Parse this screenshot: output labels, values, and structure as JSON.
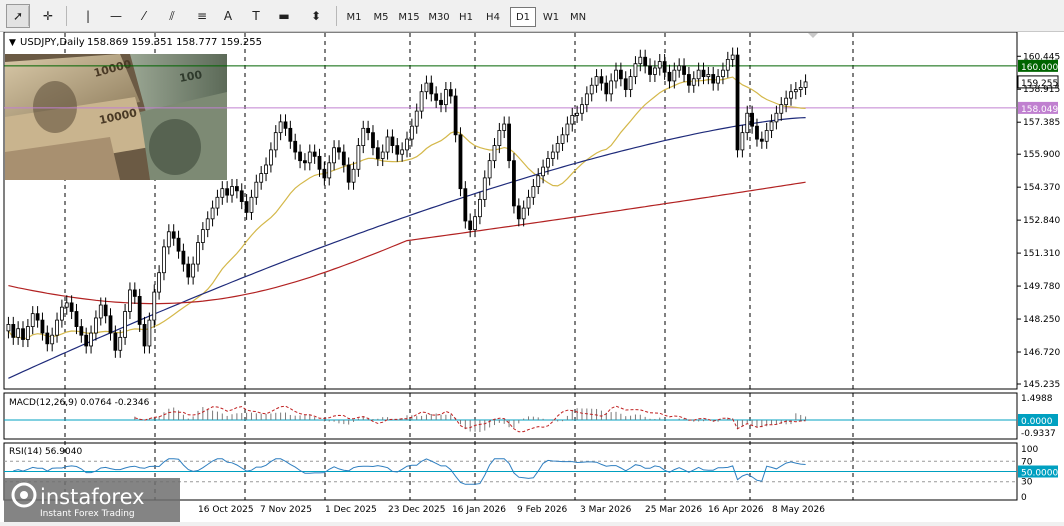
{
  "toolbar": {
    "tools": [
      {
        "name": "cursor-icon",
        "glyph": "➚"
      },
      {
        "name": "crosshair-icon",
        "glyph": "✛"
      },
      {
        "name": "vertical-line-icon",
        "glyph": "|"
      },
      {
        "name": "horizontal-line-icon",
        "glyph": "—"
      },
      {
        "name": "trendline-icon",
        "glyph": "⁄"
      },
      {
        "name": "channel-icon",
        "glyph": "⫽"
      },
      {
        "name": "fibonacci-icon",
        "glyph": "≡"
      },
      {
        "name": "text-icon",
        "glyph": "A"
      },
      {
        "name": "text-label-icon",
        "glyph": "T"
      },
      {
        "name": "rectangle-icon",
        "glyph": "▬"
      },
      {
        "name": "arrows-icon",
        "glyph": "⬍"
      }
    ],
    "timeframes": [
      "M1",
      "M5",
      "M15",
      "M30",
      "H1",
      "H4",
      "D1",
      "W1",
      "MN"
    ],
    "active_timeframe": "D1"
  },
  "chart_data": {
    "type": "candlestick",
    "symbol_label": "USDJPY,Daily",
    "ohlc_label": "158.869 159.351 158.777 159.255",
    "ylim": [
      145.235,
      161.2
    ],
    "y_ticks": [
      "160.445",
      "158.915",
      "157.385",
      "155.900",
      "154.370",
      "152.840",
      "151.310",
      "149.780",
      "148.250",
      "146.720",
      "145.235"
    ],
    "hlines": [
      {
        "price": 160.0,
        "label": "160.000",
        "color": "#006400"
      },
      {
        "price": 158.049,
        "label": "158.049",
        "color": "#c080d0"
      }
    ],
    "current_price": {
      "value": 159.255,
      "label": "159.255"
    },
    "x_labels": [
      "16 Oct 2025",
      "7 Nov 2025",
      "1 Dec 2025",
      "23 Dec 2025",
      "16 Jan 2026",
      "9 Feb 2026",
      "3 Mar 2026",
      "25 Mar 2026",
      "16 Apr 2026",
      "8 May 2026"
    ],
    "closes": [
      148.0,
      147.4,
      147.8,
      147.3,
      147.9,
      148.5,
      148.2,
      147.6,
      147.1,
      147.5,
      148.2,
      148.8,
      149.0,
      148.6,
      147.9,
      147.5,
      147.0,
      147.6,
      148.3,
      148.9,
      148.4,
      147.6,
      146.8,
      147.4,
      148.6,
      149.6,
      149.3,
      148.0,
      147.0,
      148.2,
      149.5,
      150.4,
      151.6,
      152.3,
      152.0,
      151.4,
      150.8,
      150.2,
      150.8,
      151.8,
      152.4,
      152.9,
      153.4,
      153.9,
      154.3,
      154.0,
      154.4,
      154.2,
      153.7,
      153.2,
      153.9,
      154.6,
      155.0,
      155.4,
      156.1,
      156.9,
      157.4,
      157.1,
      156.5,
      156.0,
      155.6,
      155.5,
      156.0,
      155.8,
      155.2,
      154.8,
      155.5,
      156.2,
      156.0,
      155.4,
      154.6,
      155.2,
      156.3,
      157.1,
      156.9,
      156.2,
      155.7,
      156.0,
      156.7,
      156.3,
      155.9,
      156.1,
      156.6,
      157.2,
      157.9,
      158.8,
      159.2,
      158.7,
      158.4,
      158.2,
      158.9,
      158.6,
      156.8,
      154.3,
      152.8,
      152.4,
      153.0,
      153.8,
      154.8,
      155.6,
      156.3,
      157.0,
      157.3,
      155.6,
      153.5,
      152.9,
      153.4,
      153.9,
      154.4,
      154.9,
      155.3,
      155.7,
      156.0,
      156.4,
      156.8,
      157.3,
      157.7,
      157.8,
      158.2,
      158.7,
      159.1,
      159.5,
      159.2,
      158.7,
      159.3,
      159.8,
      159.4,
      158.9,
      159.5,
      160.1,
      160.4,
      160.0,
      159.6,
      159.9,
      160.2,
      159.7,
      159.3,
      159.8,
      160.0,
      159.6,
      159.1,
      159.4,
      159.8,
      159.5,
      159.6,
      159.2,
      159.5,
      159.8,
      160.3,
      160.5,
      156.1,
      156.9,
      157.8,
      157.2,
      156.6,
      156.5,
      157.0,
      157.4,
      157.8,
      158.2,
      158.5,
      158.8,
      158.9,
      159.0,
      159.255
    ],
    "ma_yellow": {
      "start": 146.2,
      "end": 159.2,
      "color": "#d4b84a"
    },
    "ma_blue": {
      "start": 145.5,
      "end": 157.6,
      "color": "#1e2a7a"
    },
    "ma_red": {
      "start": 149.8,
      "end": 154.6,
      "color": "#b22222"
    },
    "macd": {
      "label": "MACD(12,26,9) 0.0764 -0.2346",
      "ticks": [
        "1.4988",
        "0.0000",
        "-0.9337"
      ],
      "zero_label": "0.0000"
    },
    "rsi": {
      "label": "RSI(14) 56.9040",
      "ticks": [
        "100",
        "70",
        "50.0000",
        "30",
        "0"
      ],
      "level_label": "50.0000"
    },
    "watermark": {
      "brand": "instaforex",
      "tagline": "Instant Forex Trading"
    }
  }
}
